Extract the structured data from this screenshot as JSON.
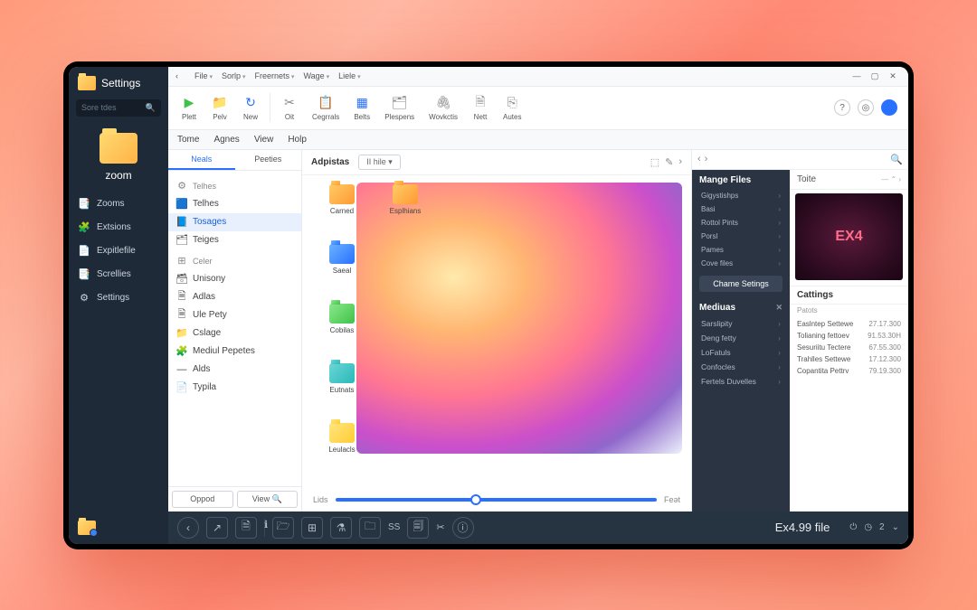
{
  "sidebar": {
    "title": "Settings",
    "search_placeholder": "Sore tdes",
    "zoom_label": "zoom",
    "items": [
      {
        "icon": "📑",
        "label": "Zooms"
      },
      {
        "icon": "🧩",
        "label": "Extsions"
      },
      {
        "icon": "📄",
        "label": "Expitlefile"
      },
      {
        "icon": "📑",
        "label": "Screllies"
      },
      {
        "icon": "⚙",
        "label": "Settings"
      }
    ]
  },
  "titlebar": {
    "back": "‹",
    "menu": [
      "File",
      "Sorlp",
      "Freernets",
      "Wage",
      "Liele"
    ]
  },
  "ribbon": {
    "items": [
      {
        "icon": "▶",
        "label": "Plett",
        "color": "#3fc24a"
      },
      {
        "icon": "📁",
        "label": "Pelv",
        "color": "#ff9933"
      },
      {
        "icon": "↻",
        "label": "New",
        "color": "#2970ff"
      },
      {
        "icon": "✂",
        "label": "Oit",
        "color": "#888"
      },
      {
        "icon": "📋",
        "label": "Cegrrals",
        "color": "#888"
      },
      {
        "icon": "▦",
        "label": "Belts",
        "color": "#2970ff"
      },
      {
        "icon": "🗂",
        "label": "Plespens",
        "color": "#888"
      },
      {
        "icon": "🖇",
        "label": "Wovkctis",
        "color": "#888"
      },
      {
        "icon": "🗎",
        "label": "Nett",
        "color": "#888"
      },
      {
        "icon": "⎘",
        "label": "Autes",
        "color": "#888"
      }
    ]
  },
  "menubar": [
    "Tome",
    "Agnes",
    "View",
    "Holp"
  ],
  "tree": {
    "tabs": [
      "Neals",
      "Peeties"
    ],
    "rows": [
      {
        "icon": "🟦",
        "label": "Telhes",
        "sel": false
      },
      {
        "icon": "📘",
        "label": "Tosages",
        "sel": true
      },
      {
        "icon": "🗂",
        "label": "Teiges",
        "sel": false
      },
      {
        "icon": "🗃",
        "label": "Unisony",
        "sel": false
      },
      {
        "icon": "🗎",
        "label": "Adlas",
        "sel": false
      },
      {
        "icon": "🗎",
        "label": "Ule Pety",
        "sel": false
      },
      {
        "icon": "📁",
        "label": "Cslage",
        "sel": false
      },
      {
        "icon": "🧩",
        "label": "Mediul Pepetes",
        "sel": false
      },
      {
        "icon": "—",
        "label": "Alds",
        "sel": false
      },
      {
        "icon": "📄",
        "label": "Typila",
        "sel": false
      }
    ],
    "groups": [
      {
        "icon": "⚙",
        "label": "Telhes"
      },
      {
        "icon": "⊞",
        "label": "Celer"
      }
    ],
    "foot": [
      "Oppod",
      "View"
    ]
  },
  "center": {
    "title": "Adpistas",
    "dropdown": "II hile",
    "files": [
      {
        "label": "Carned",
        "c": "c-orange"
      },
      {
        "label": "Esplhians",
        "c": "c-orange"
      },
      {
        "label": "Saeal",
        "c": "c-blue"
      },
      {
        "label": "",
        "c": ""
      },
      {
        "label": "Cobilas",
        "c": "c-green"
      },
      {
        "label": "",
        "c": ""
      },
      {
        "label": "Eutnats",
        "c": "c-teal"
      },
      {
        "label": "",
        "c": ""
      },
      {
        "label": "Leulacls",
        "c": "c-yellow"
      }
    ],
    "slider": {
      "left": "Lids",
      "right": "Feət"
    }
  },
  "rpane": {
    "manage_title": "Mange Files",
    "manage_items": [
      "Gigystishps",
      "Basi",
      "Rottol Pints",
      "Porsl",
      "Pames",
      "Cove files"
    ],
    "chname_btn": "Chame Setings",
    "medias_title": "Mediuas",
    "medias_items": [
      "Sarslipity",
      "Deng fetty",
      "LoFatuls",
      "Confocles",
      "Fertels Duvelles"
    ],
    "toite": "Toite",
    "preview_label": "EX4",
    "cattings": "Cattings",
    "cat_sub": "Patots",
    "cat_rows": [
      {
        "k": "Easlntep Settewe",
        "v": "27.17.300"
      },
      {
        "k": "Tolianing fettoev",
        "v": "91.53.30H"
      },
      {
        "k": "Sesuriitu Tectere",
        "v": "67.55.300"
      },
      {
        "k": "Trahlles Settewe",
        "v": "17.12.300"
      },
      {
        "k": "Copantita Pettrv",
        "v": "79.19.300"
      }
    ]
  },
  "status": {
    "label": "Ex4.99 file",
    "num": "2"
  }
}
